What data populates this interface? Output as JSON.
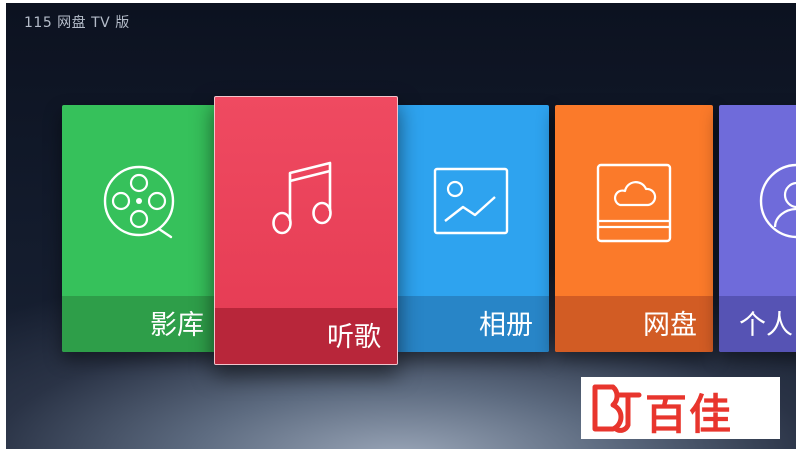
{
  "app": {
    "title": "115 网盘 TV 版"
  },
  "tiles": [
    {
      "label": "影库",
      "icon": "film-reel-icon",
      "color": "#36c15b"
    },
    {
      "label": "听歌",
      "icon": "music-note-icon",
      "color": "#ef4a61",
      "focused": true
    },
    {
      "label": "相册",
      "icon": "image-icon",
      "color": "#2ea3ef"
    },
    {
      "label": "网盘",
      "icon": "cloud-drive-icon",
      "color": "#fb7a2a"
    },
    {
      "label": "个人",
      "icon": "avatar-icon",
      "color": "#6f6bda"
    }
  ],
  "watermark": {
    "text": "百佳",
    "color": "#e8352d"
  }
}
